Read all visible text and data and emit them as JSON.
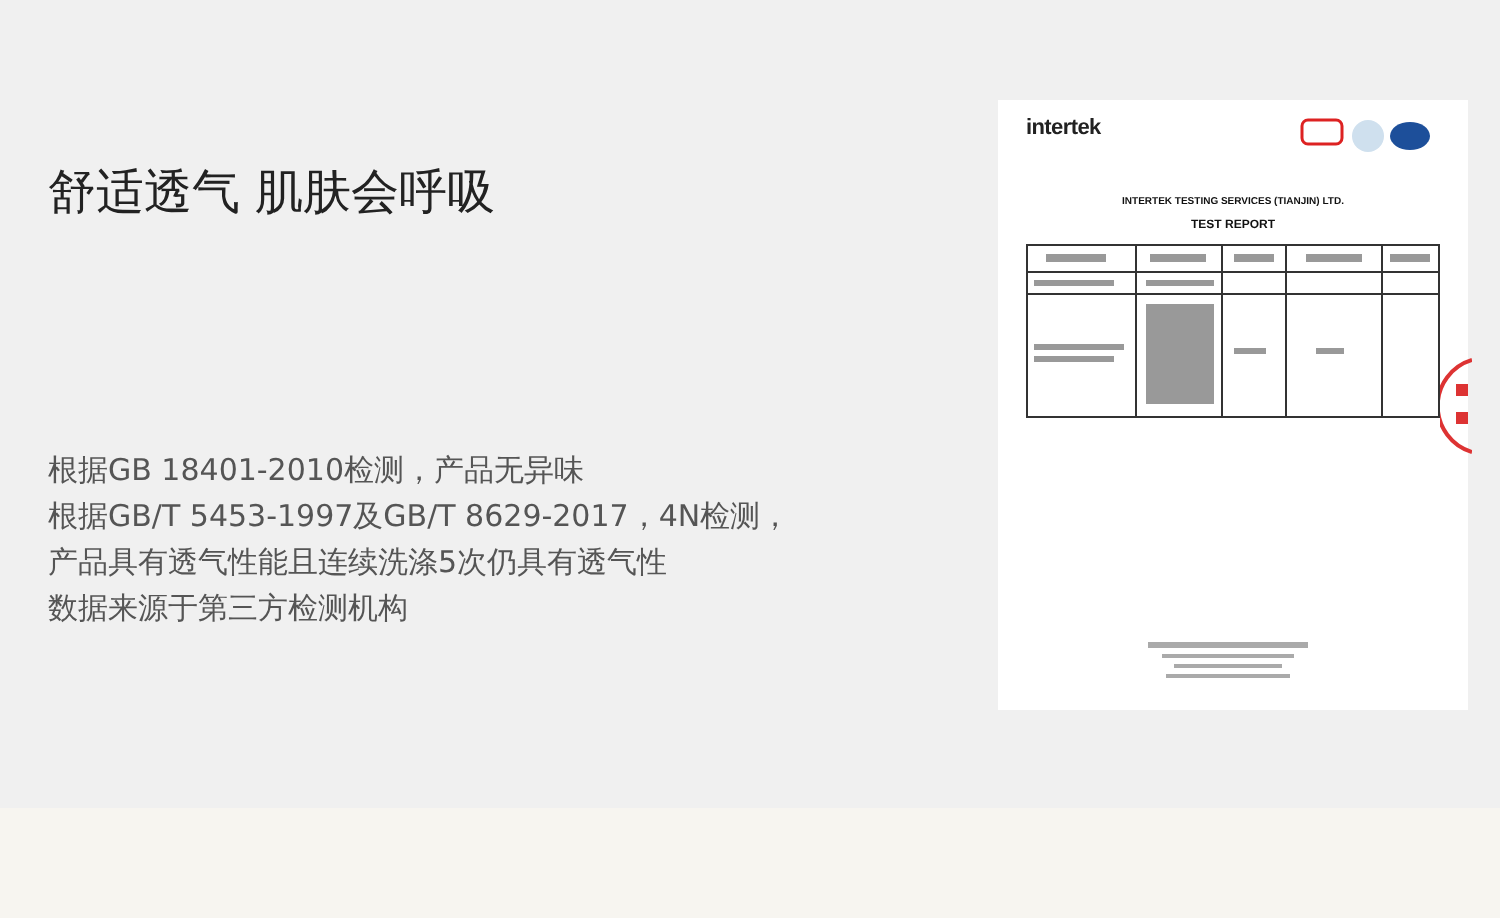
{
  "feature": {
    "title": "舒适透气 肌肤会呼吸",
    "lines": [
      "根据GB 18401-2010检测，产品无异味",
      "根据GB/T 5453-1997及GB/T 8629-2017，4N检测，",
      "产品具有透气性能且连续洗涤5次仍具有透气性",
      "数据来源于第三方检测机构"
    ]
  },
  "report": {
    "logo": "intertek",
    "company": "INTERTEK TESTING SERVICES (TIANJIN) LTD.",
    "heading": "TEST REPORT"
  }
}
